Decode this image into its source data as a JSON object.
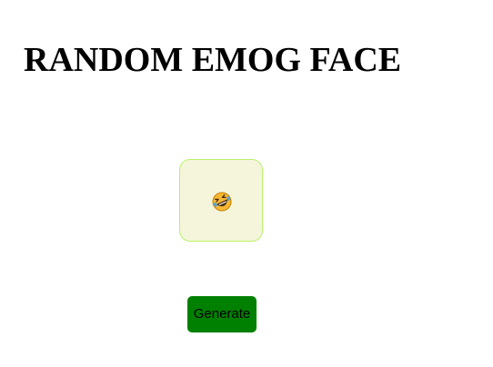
{
  "page": {
    "title": "RANDOM EMOG FACE"
  },
  "emoji_card": {
    "emoji_icon": "rolling-on-the-floor-laughing-face-icon",
    "background_color": "#f5f5dc",
    "border_color": "#b9f26a"
  },
  "actions": {
    "generate_label": "Generate",
    "generate_color": "#008000"
  }
}
